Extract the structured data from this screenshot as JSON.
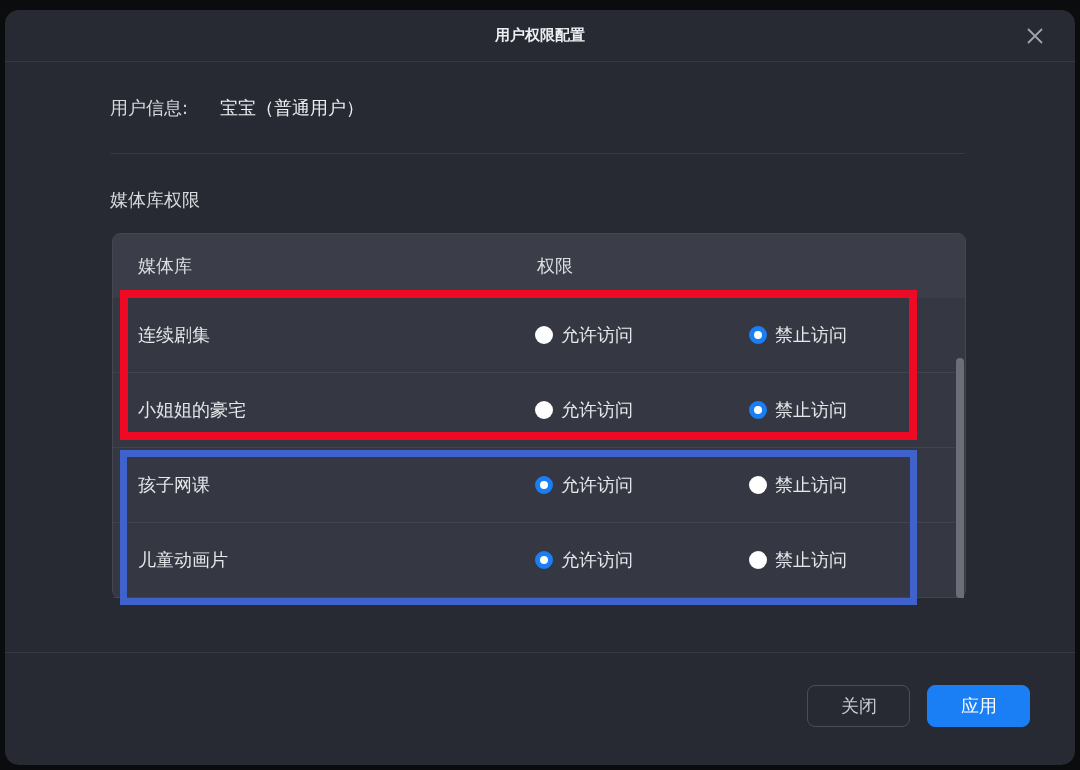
{
  "dialog": {
    "title": "用户权限配置"
  },
  "user_info": {
    "label": "用户信息:",
    "value": "宝宝（普通用户）"
  },
  "section_title": "媒体库权限",
  "table": {
    "columns": [
      "媒体库",
      "权限"
    ],
    "groups": [
      {
        "color": "#ee0a24",
        "rows": [
          {
            "name": "连续剧集",
            "options": [
              {
                "label": "允许访问",
                "selected": false
              },
              {
                "label": "禁止访问",
                "selected": true
              }
            ]
          },
          {
            "name": "小姐姐的豪宅",
            "options": [
              {
                "label": "允许访问",
                "selected": false
              },
              {
                "label": "禁止访问",
                "selected": true
              }
            ]
          }
        ]
      },
      {
        "color": "#4062cc",
        "rows": [
          {
            "name": "孩子网课",
            "options": [
              {
                "label": "允许访问",
                "selected": true
              },
              {
                "label": "禁止访问",
                "selected": false
              }
            ]
          },
          {
            "name": "儿童动画片",
            "options": [
              {
                "label": "允许访问",
                "selected": true
              },
              {
                "label": "禁止访问",
                "selected": false
              }
            ]
          }
        ]
      }
    ]
  },
  "buttons": [
    {
      "label": "关闭",
      "kind": "secondary"
    },
    {
      "label": "应用",
      "kind": "primary"
    }
  ]
}
